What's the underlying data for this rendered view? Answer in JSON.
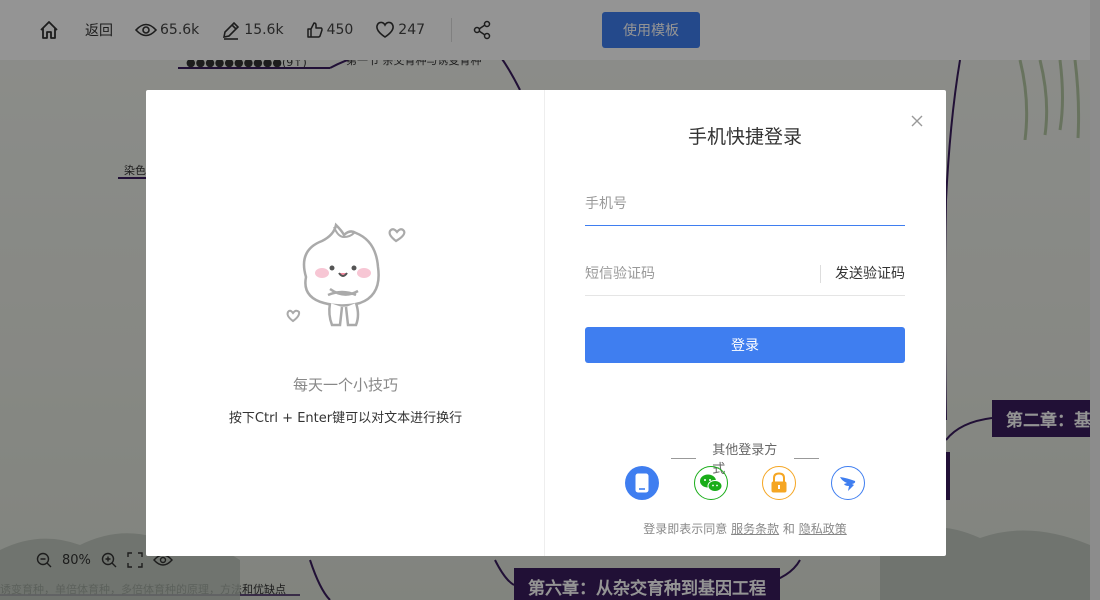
{
  "toolbar": {
    "back_label": "返回",
    "views": "65.6k",
    "edits": "15.6k",
    "likes": "450",
    "favorites": "247",
    "use_template_label": "使用模板"
  },
  "background": {
    "chapter2": "第二章：基因",
    "chapter6": "第六章：从杂交育种到基因工程",
    "branch_dye": "染色",
    "branch_top": "第一节 杂交育种与诱变育种",
    "bottom_text": "诱变育种，单倍体育种，多倍体育种的原理，方法和优缺点"
  },
  "zoom": {
    "level": "80%"
  },
  "modal": {
    "tip_title": "每天一个小技巧",
    "tip_text": "按下Ctrl + Enter键可以对文本进行换行",
    "login_title": "手机快捷登录",
    "phone_placeholder": "手机号",
    "code_placeholder": "短信验证码",
    "send_code_label": "发送验证码",
    "login_button": "登录",
    "other_methods": "其他登录方式",
    "agree_prefix": "登录即表示同意",
    "terms_link": "服务条款",
    "and": "和",
    "privacy_link": "隐私政策",
    "other_icons": [
      "phone-icon",
      "wechat-icon",
      "lock-icon",
      "dingtalk-icon"
    ],
    "colors": {
      "primary": "#3f7ef0",
      "wechat": "#1aad19",
      "lock": "#f5a623"
    }
  }
}
